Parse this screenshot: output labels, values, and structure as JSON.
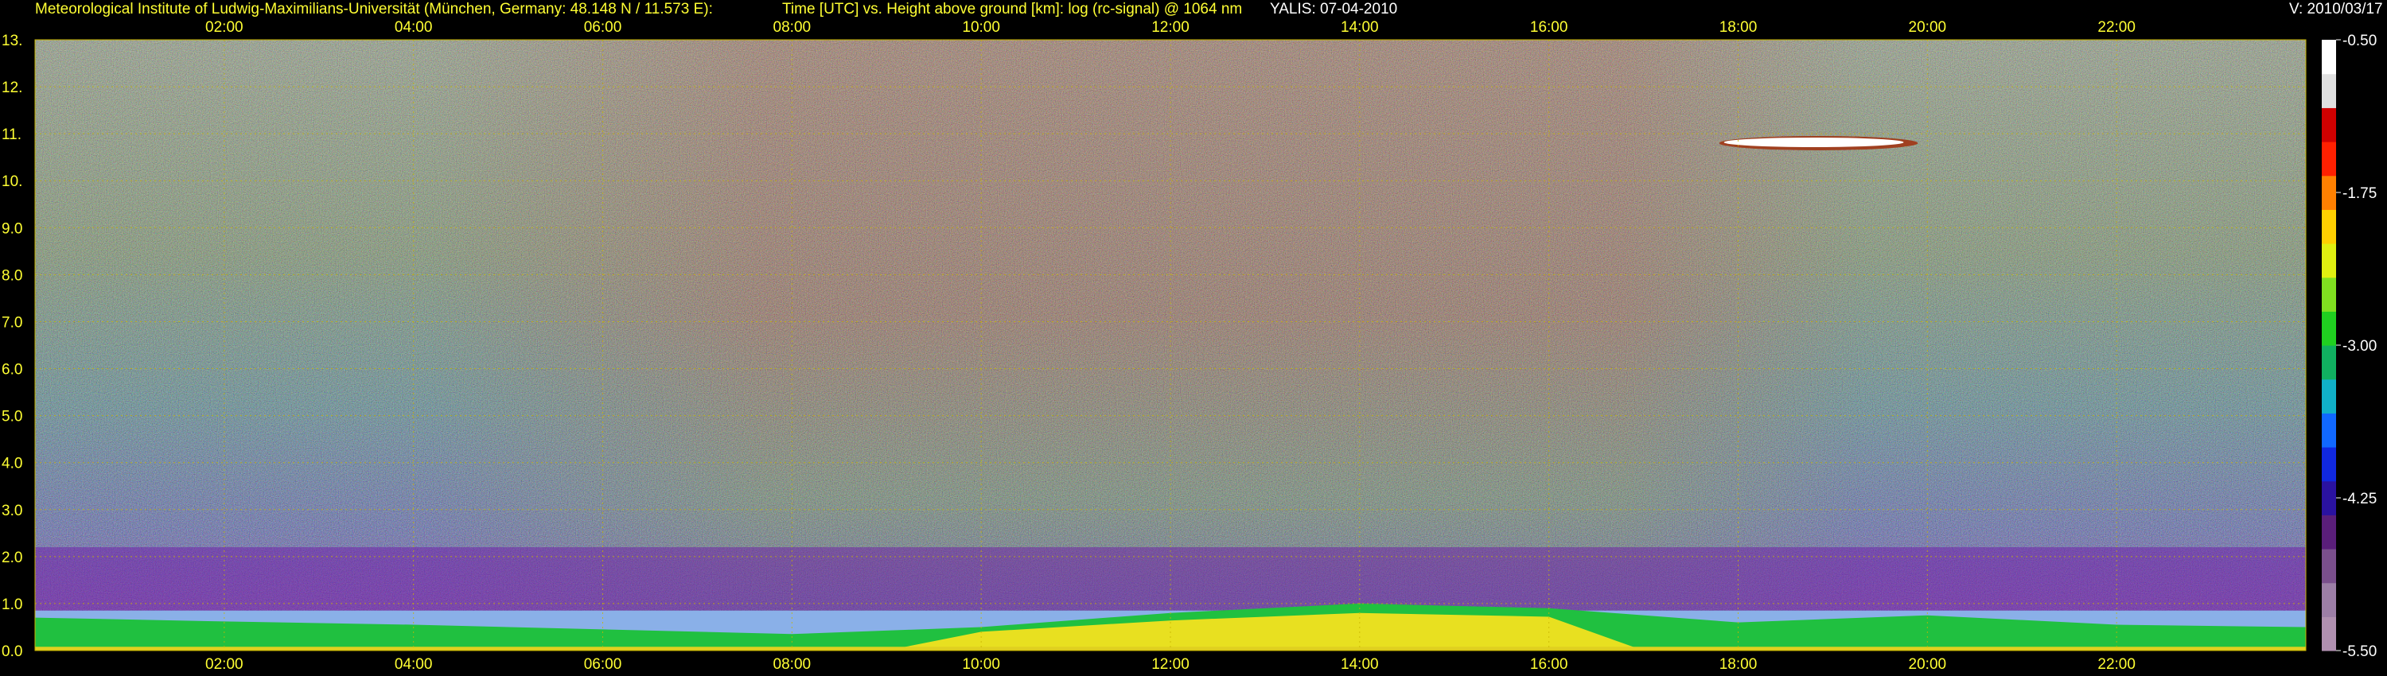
{
  "header": {
    "institute": "Meteorological Institute of Ludwig-Maximilians-Universität (München, Germany: 48.148 N / 11.573 E):",
    "description": "Time [UTC] vs. Height above ground [km]: log (rc-signal) @ 1064 nm",
    "instrument": "YALIS: 07-04-2010",
    "version": "V: 2010/03/17"
  },
  "chart_data": {
    "type": "heatmap",
    "title": "Time [UTC] vs. Height above ground [km]: log (rc-signal) @ 1064 nm",
    "xlabel": "Time [UTC]",
    "ylabel": "Height above ground [km]",
    "xlim": [
      0.0,
      24.0
    ],
    "ylim": [
      0.0,
      13.0
    ],
    "grid": true,
    "x_ticks": [
      {
        "value": 2,
        "label": "02:00"
      },
      {
        "value": 4,
        "label": "04:00"
      },
      {
        "value": 6,
        "label": "06:00"
      },
      {
        "value": 8,
        "label": "08:00"
      },
      {
        "value": 10,
        "label": "10:00"
      },
      {
        "value": 12,
        "label": "12:00"
      },
      {
        "value": 14,
        "label": "14:00"
      },
      {
        "value": 16,
        "label": "16:00"
      },
      {
        "value": 18,
        "label": "18:00"
      },
      {
        "value": 20,
        "label": "20:00"
      },
      {
        "value": 22,
        "label": "22:00"
      }
    ],
    "y_ticks": [
      {
        "value": 0,
        "label": "0.0"
      },
      {
        "value": 1,
        "label": "1.0"
      },
      {
        "value": 2,
        "label": "2.0"
      },
      {
        "value": 3,
        "label": "3.0"
      },
      {
        "value": 4,
        "label": "4.0"
      },
      {
        "value": 5,
        "label": "5.0"
      },
      {
        "value": 6,
        "label": "6.0"
      },
      {
        "value": 7,
        "label": "7.0"
      },
      {
        "value": 8,
        "label": "8.0"
      },
      {
        "value": 9,
        "label": "9.0"
      },
      {
        "value": 10,
        "label": "10."
      },
      {
        "value": 11,
        "label": "11."
      },
      {
        "value": 12,
        "label": "12."
      },
      {
        "value": 13,
        "label": "13."
      }
    ],
    "colorbar": {
      "range": [
        -5.5,
        -0.5
      ],
      "ticks": [
        {
          "value": -0.5,
          "label": "-0.50"
        },
        {
          "value": -1.75,
          "label": "-1.75"
        },
        {
          "value": -3.0,
          "label": "-3.00"
        },
        {
          "value": -4.25,
          "label": "-4.25"
        },
        {
          "value": -5.5,
          "label": "-5.50"
        }
      ],
      "colors": [
        "#b090b0",
        "#9c7ea6",
        "#7a4f8c",
        "#5a1e7a",
        "#2a12a0",
        "#1028e0",
        "#1068ff",
        "#10b0c8",
        "#10b060",
        "#20d020",
        "#80e020",
        "#e0f010",
        "#ffd000",
        "#ff8000",
        "#ff2000",
        "#d00000",
        "#e0e0e0",
        "#ffffff"
      ]
    },
    "features": {
      "boundary_layer_top_km": [
        {
          "t": 0.0,
          "h": 0.7
        },
        {
          "t": 2.0,
          "h": 0.62
        },
        {
          "t": 4.0,
          "h": 0.55
        },
        {
          "t": 6.0,
          "h": 0.45
        },
        {
          "t": 8.0,
          "h": 0.35
        },
        {
          "t": 10.0,
          "h": 0.5
        },
        {
          "t": 12.0,
          "h": 0.8
        },
        {
          "t": 14.0,
          "h": 1.0
        },
        {
          "t": 16.0,
          "h": 0.9
        },
        {
          "t": 18.0,
          "h": 0.6
        },
        {
          "t": 20.0,
          "h": 0.75
        },
        {
          "t": 22.0,
          "h": 0.55
        },
        {
          "t": 24.0,
          "h": 0.5
        }
      ],
      "residual_layer_top_km": 0.85,
      "cirrus_cloud": {
        "t_start": 17.8,
        "t_end": 19.9,
        "h_km": 10.8
      }
    }
  }
}
